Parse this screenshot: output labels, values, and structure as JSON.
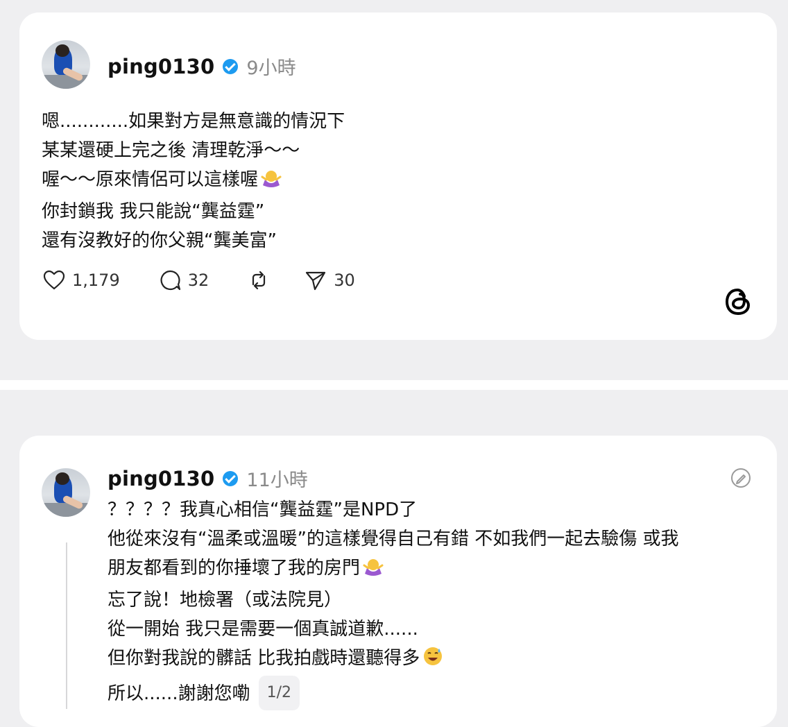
{
  "post1": {
    "username": "ping0130",
    "time": "9小時",
    "lines": [
      "嗯............如果對方是無意識的情況下",
      "某某還硬上完之後 清理乾淨～～",
      "喔～～原來情侶可以這樣喔",
      "你封鎖我 我只能說“龔益霆”",
      "還有沒教好的你父親“龔美富”"
    ],
    "likes": "1,179",
    "comments": "32",
    "shares": "30"
  },
  "post2": {
    "username": "ping0130",
    "time": "11小時",
    "lines": [
      "？？？？我真心相信“龔益霆”是NPD了",
      "他從來沒有“溫柔或溫暖”的這樣覺得自己有錯 不如我們一起去驗傷 或我",
      "朋友都看到的你捶壞了我的房門",
      "忘了說！地檢署（或法院見）",
      "從一開始 我只是需要一個真誠道歉......",
      "但你對我說的髒話 比我拍戲時還聽得多",
      "所以......謝謝您嘞"
    ],
    "page_indicator": "1/2"
  }
}
